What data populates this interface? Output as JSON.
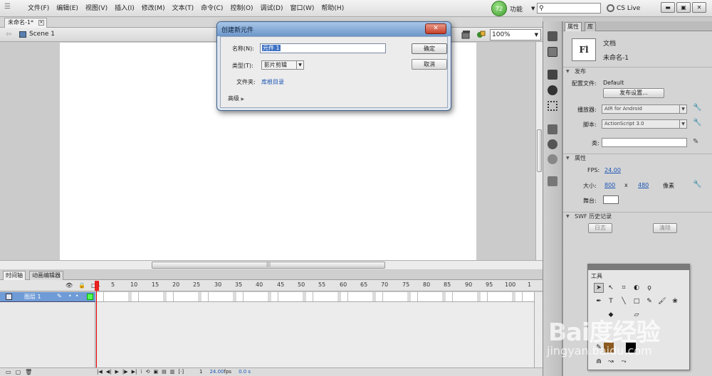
{
  "menubar": {
    "items": [
      "文件(F)",
      "编辑(E)",
      "视图(V)",
      "插入(I)",
      "修改(M)",
      "文本(T)",
      "命令(C)",
      "控制(O)",
      "调试(D)",
      "窗口(W)",
      "帮助(H)"
    ],
    "workspace_badge": "72",
    "workspace_label": "功能",
    "cs_live": "CS Live",
    "search_placeholder": ""
  },
  "document": {
    "tab_label": "未命名-1*",
    "scene_name": "Scene 1",
    "zoom": "100%"
  },
  "timeline": {
    "tab_timeline": "时间轴",
    "tab_motion_editor": "动画编辑器",
    "ruler": [
      "1",
      "5",
      "10",
      "15",
      "20",
      "25",
      "30",
      "35",
      "40",
      "45",
      "50",
      "55",
      "60",
      "65",
      "70",
      "75",
      "80",
      "85",
      "90",
      "95",
      "100",
      "1"
    ],
    "layer_name": "图层 1",
    "frame_number": "1",
    "fps": "24.00",
    "fps_unit": "fps",
    "time": "0.0 s"
  },
  "properties": {
    "tab_properties": "属性",
    "tab_library": "库",
    "doc_icon": "Fl",
    "doc_kind": "文档",
    "doc_name": "未命名-1",
    "publish_header": "发布",
    "profile_label": "配置文件:",
    "profile_value": "Default",
    "publish_settings_button": "发布设置...",
    "player_label": "播放器:",
    "player_value": "AIR for Android",
    "script_label": "脚本:",
    "script_value": "ActionScript 3.0",
    "class_label": "类:",
    "props_header": "属性",
    "fps_label": "FPS:",
    "fps_value": "24.00",
    "size_label": "大小:",
    "width": "800",
    "x": "x",
    "height": "480",
    "unit": "像素",
    "stage_label": "舞台:",
    "history_header": "SWF 历史记录",
    "log_button": "日志",
    "clear_button": "清除"
  },
  "tools": {
    "title": "工具"
  },
  "watermark": {
    "main": "Bai度经验",
    "sub": "jingyan.baidu.com"
  },
  "dialog": {
    "title": "创建新元件",
    "close_glyph": "✕",
    "name_label": "名称(N):",
    "name_value": "元件 1",
    "type_label": "类型(T):",
    "type_value": "影片剪辑",
    "folder_label": "文件夹:",
    "folder_value": "库根目录",
    "advanced_label": "高级",
    "ok_label": "确定",
    "cancel_label": "取消"
  },
  "colors": {
    "accent": "#1a55b5",
    "layer_highlight": "#6f9bd6",
    "playhead": "#e00000",
    "dialog_title": "#6b96c9"
  }
}
